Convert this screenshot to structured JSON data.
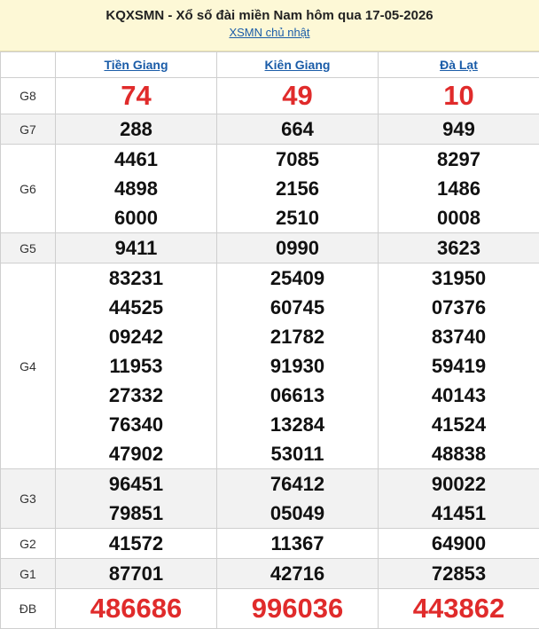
{
  "header": {
    "title": "KQXSMN - Xổ số đài miền Nam hôm qua 17-05-2026",
    "subtitle_link": "XSMN chủ nhật"
  },
  "provinces": [
    "Tiền Giang",
    "Kiên Giang",
    "Đà Lạt"
  ],
  "prizes": {
    "g8": {
      "label": "G8",
      "values": [
        [
          "74"
        ],
        [
          "49"
        ],
        [
          "10"
        ]
      ]
    },
    "g7": {
      "label": "G7",
      "values": [
        [
          "288"
        ],
        [
          "664"
        ],
        [
          "949"
        ]
      ]
    },
    "g6": {
      "label": "G6",
      "values": [
        [
          "4461",
          "4898",
          "6000"
        ],
        [
          "7085",
          "2156",
          "2510"
        ],
        [
          "8297",
          "1486",
          "0008"
        ]
      ]
    },
    "g5": {
      "label": "G5",
      "values": [
        [
          "9411"
        ],
        [
          "0990"
        ],
        [
          "3623"
        ]
      ]
    },
    "g4": {
      "label": "G4",
      "values": [
        [
          "83231",
          "44525",
          "09242",
          "11953",
          "27332",
          "76340",
          "47902"
        ],
        [
          "25409",
          "60745",
          "21782",
          "91930",
          "06613",
          "13284",
          "53011"
        ],
        [
          "31950",
          "07376",
          "83740",
          "59419",
          "40143",
          "41524",
          "48838"
        ]
      ]
    },
    "g3": {
      "label": "G3",
      "values": [
        [
          "96451",
          "79851"
        ],
        [
          "76412",
          "05049"
        ],
        [
          "90022",
          "41451"
        ]
      ]
    },
    "g2": {
      "label": "G2",
      "values": [
        [
          "41572"
        ],
        [
          "11367"
        ],
        [
          "64900"
        ]
      ]
    },
    "g1": {
      "label": "G1",
      "values": [
        [
          "87701"
        ],
        [
          "42716"
        ],
        [
          "72853"
        ]
      ]
    },
    "db": {
      "label": "ĐB",
      "values": [
        [
          "486686"
        ],
        [
          "996036"
        ],
        [
          "443862"
        ]
      ]
    }
  },
  "colors": {
    "header_bg": "#fdf8d6",
    "link": "#1a5ca8",
    "highlight_red": "#e02b2b",
    "shade_row": "#f2f2f2"
  }
}
